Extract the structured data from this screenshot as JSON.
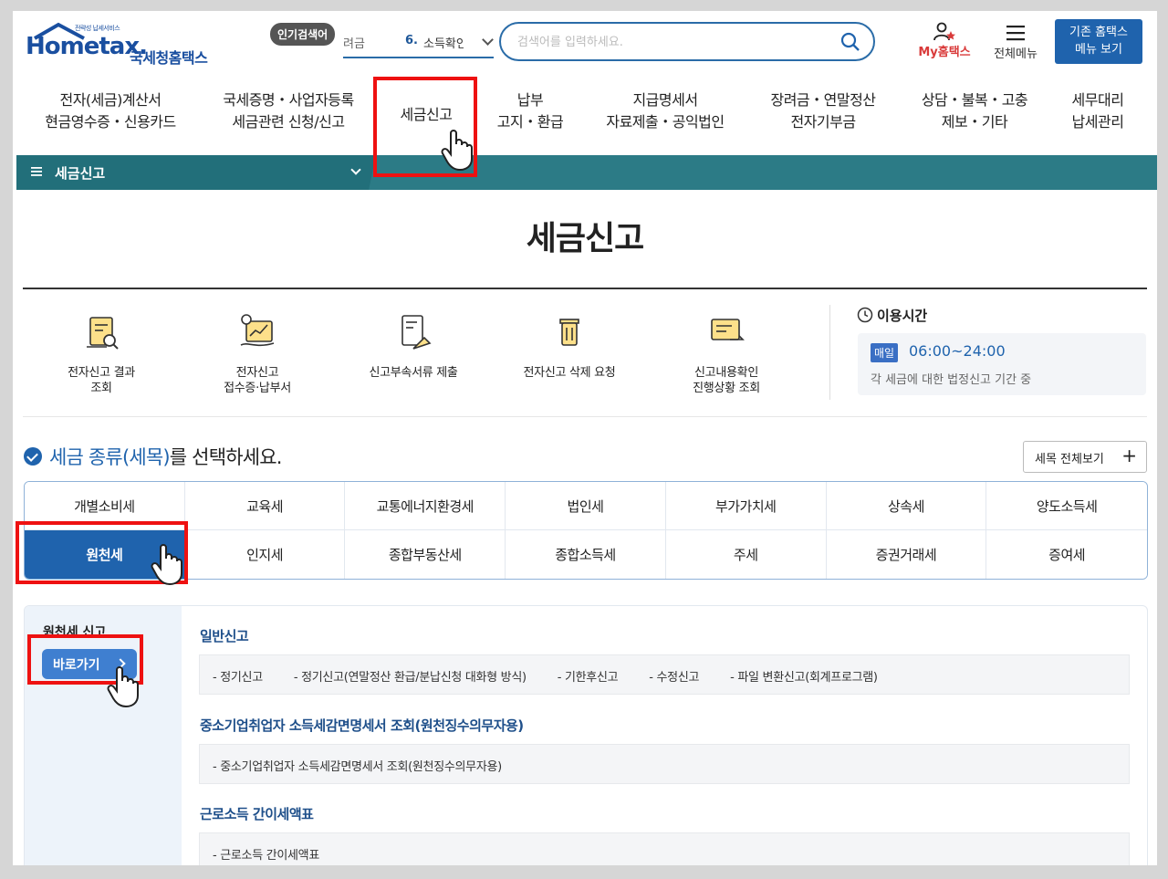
{
  "header": {
    "logo_small": "전략성 납세서비스",
    "logo_main": "Hometax.",
    "logo_sub": "국세청홈택스",
    "popular_badge": "인기검색어",
    "popular_prev": "려금",
    "popular_num": "6.",
    "popular_word": "소득확인",
    "search_placeholder": "검색어를 입력하세요.",
    "my_home": "My홈택스",
    "all_menu": "전체메뉴",
    "old_menu_line1": "기존 홈택스",
    "old_menu_line2": "메뉴 보기"
  },
  "gnb": [
    {
      "l1": "전자(세금)계산서",
      "l2": "현금영수증・신용카드"
    },
    {
      "l1": "국세증명・사업자등록",
      "l2": "세금관련 신청/신고"
    },
    {
      "l1": "세금신고",
      "l2": ""
    },
    {
      "l1": "납부",
      "l2": "고지・환급"
    },
    {
      "l1": "지급명세서",
      "l2": "자료제출・공익법인"
    },
    {
      "l1": "장려금・연말정산",
      "l2": "전자기부금"
    },
    {
      "l1": "상담・불복・고충",
      "l2": "제보・기타"
    },
    {
      "l1": "세무대리",
      "l2": "납세관리"
    }
  ],
  "subbar": {
    "title": "세금신고"
  },
  "page_title": "세금신고",
  "quick_links": [
    {
      "l1": "전자신고 결과",
      "l2": "조회"
    },
    {
      "l1": "전자신고",
      "l2": "접수증·납부서"
    },
    {
      "l1": "신고부속서류 제출",
      "l2": ""
    },
    {
      "l1": "전자신고 삭제 요청",
      "l2": ""
    },
    {
      "l1": "신고내용확인",
      "l2": "진행상황 조회"
    }
  ],
  "hours": {
    "title": "이용시간",
    "badge": "매일",
    "time": "06:00~24:00",
    "note": "각 세금에 대한 법정신고 기간 중"
  },
  "select": {
    "prefix": "세금 종류(세목)",
    "suffix": "를 선택하세요.",
    "view_all": "세목 전체보기",
    "view_all_icon": "+"
  },
  "tax_types": [
    "개별소비세",
    "교육세",
    "교통에너지환경세",
    "법인세",
    "부가가치세",
    "상속세",
    "양도소득세",
    "원천세",
    "인지세",
    "종합부동산세",
    "종합소득세",
    "주세",
    "증권거래세",
    "증여세"
  ],
  "active_tax": "원천세",
  "detail": {
    "side_title": "원천세 신고",
    "goto_label": "바로가기",
    "groups": [
      {
        "title": "일반신고",
        "items": [
          "- 정기신고",
          "- 정기신고(연말정산 환급/분납신청 대화형 방식)",
          "- 기한후신고",
          "- 수정신고",
          "- 파일 변환신고(회계프로그램)"
        ]
      },
      {
        "title": "중소기업취업자 소득세감면명세서 조회(원천징수의무자용)",
        "items": [
          "- 중소기업취업자 소득세감면명세서 조회(원천징수의무자용)"
        ]
      },
      {
        "title": "근로소득 간이세액표",
        "items": [
          "- 근로소득 간이세액표"
        ]
      }
    ]
  },
  "colors": {
    "accent": "#1f63ad",
    "highlight": "#e11111",
    "subbar": "#2c7b86"
  }
}
